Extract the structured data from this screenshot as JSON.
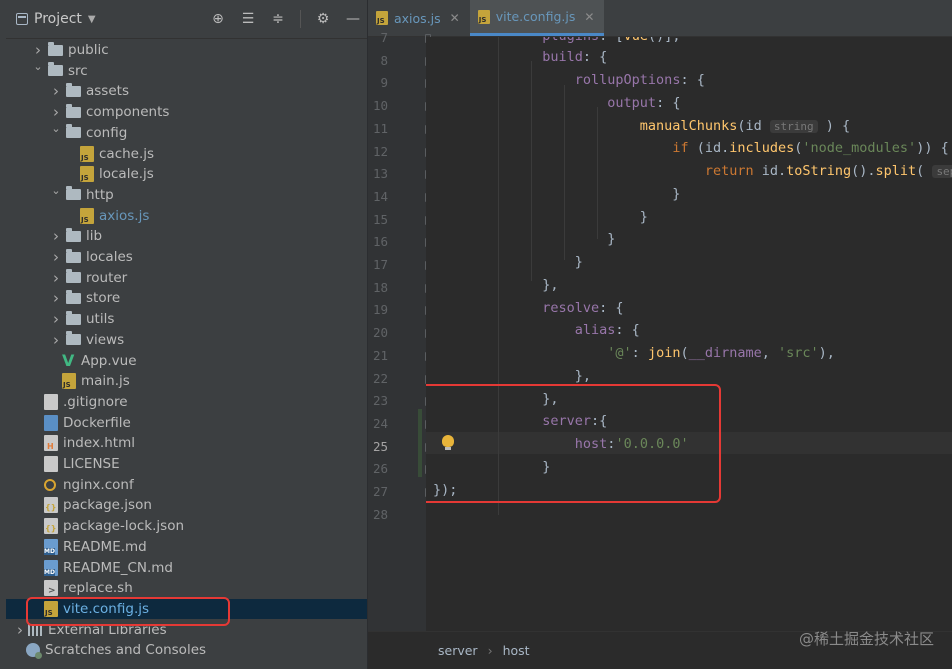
{
  "project": {
    "title": "Project",
    "tree": [
      {
        "label": "public",
        "type": "folder",
        "depth": 1,
        "expanded": false
      },
      {
        "label": "src",
        "type": "folder",
        "depth": 1,
        "expanded": true
      },
      {
        "label": "assets",
        "type": "folder",
        "depth": 2,
        "expanded": false
      },
      {
        "label": "components",
        "type": "folder",
        "depth": 2,
        "expanded": false
      },
      {
        "label": "config",
        "type": "folder",
        "depth": 2,
        "expanded": true
      },
      {
        "label": "cache.js",
        "type": "js",
        "depth": 3
      },
      {
        "label": "locale.js",
        "type": "js",
        "depth": 3
      },
      {
        "label": "http",
        "type": "folder",
        "depth": 2,
        "expanded": true
      },
      {
        "label": "axios.js",
        "type": "js",
        "depth": 3,
        "modified": true
      },
      {
        "label": "lib",
        "type": "folder",
        "depth": 2,
        "expanded": false
      },
      {
        "label": "locales",
        "type": "folder",
        "depth": 2,
        "expanded": false
      },
      {
        "label": "router",
        "type": "folder",
        "depth": 2,
        "expanded": false
      },
      {
        "label": "store",
        "type": "folder",
        "depth": 2,
        "expanded": false
      },
      {
        "label": "utils",
        "type": "folder",
        "depth": 2,
        "expanded": false
      },
      {
        "label": "views",
        "type": "folder",
        "depth": 2,
        "expanded": false
      },
      {
        "label": "App.vue",
        "type": "vue",
        "depth": 2
      },
      {
        "label": "main.js",
        "type": "js",
        "depth": 2
      },
      {
        "label": ".gitignore",
        "type": "plain",
        "depth": 1
      },
      {
        "label": "Dockerfile",
        "type": "docker",
        "depth": 1
      },
      {
        "label": "index.html",
        "type": "html",
        "depth": 1
      },
      {
        "label": "LICENSE",
        "type": "plain",
        "depth": 1
      },
      {
        "label": "nginx.conf",
        "type": "nginx",
        "depth": 1
      },
      {
        "label": "package.json",
        "type": "json",
        "depth": 1
      },
      {
        "label": "package-lock.json",
        "type": "json",
        "depth": 1
      },
      {
        "label": "README.md",
        "type": "md",
        "depth": 1
      },
      {
        "label": "README_CN.md",
        "type": "md",
        "depth": 1
      },
      {
        "label": "replace.sh",
        "type": "sh",
        "depth": 1
      },
      {
        "label": "vite.config.js",
        "type": "js",
        "depth": 1,
        "selected": true
      },
      {
        "label": "External Libraries",
        "type": "lib",
        "depth": 0,
        "expanded": false
      },
      {
        "label": "Scratches and Consoles",
        "type": "scratch",
        "depth": 0
      }
    ]
  },
  "tabs": [
    {
      "label": "axios.js",
      "active": false
    },
    {
      "label": "vite.config.js",
      "active": true
    }
  ],
  "editor": {
    "line_numbers": [
      "7",
      "8",
      "9",
      "10",
      "11",
      "12",
      "13",
      "14",
      "15",
      "16",
      "17",
      "18",
      "19",
      "20",
      "21",
      "22",
      "23",
      "24",
      "25",
      "26",
      "27",
      "28"
    ],
    "current_line": "25",
    "hints": {
      "id_type": "string",
      "separator": "separator:"
    }
  },
  "breadcrumb": [
    "server",
    "host"
  ],
  "watermark": "@稀土掘金技术社区",
  "colors": {
    "highlight": "#e53935",
    "selection": "#0d293e",
    "tab_underline": "#4a88c7"
  }
}
